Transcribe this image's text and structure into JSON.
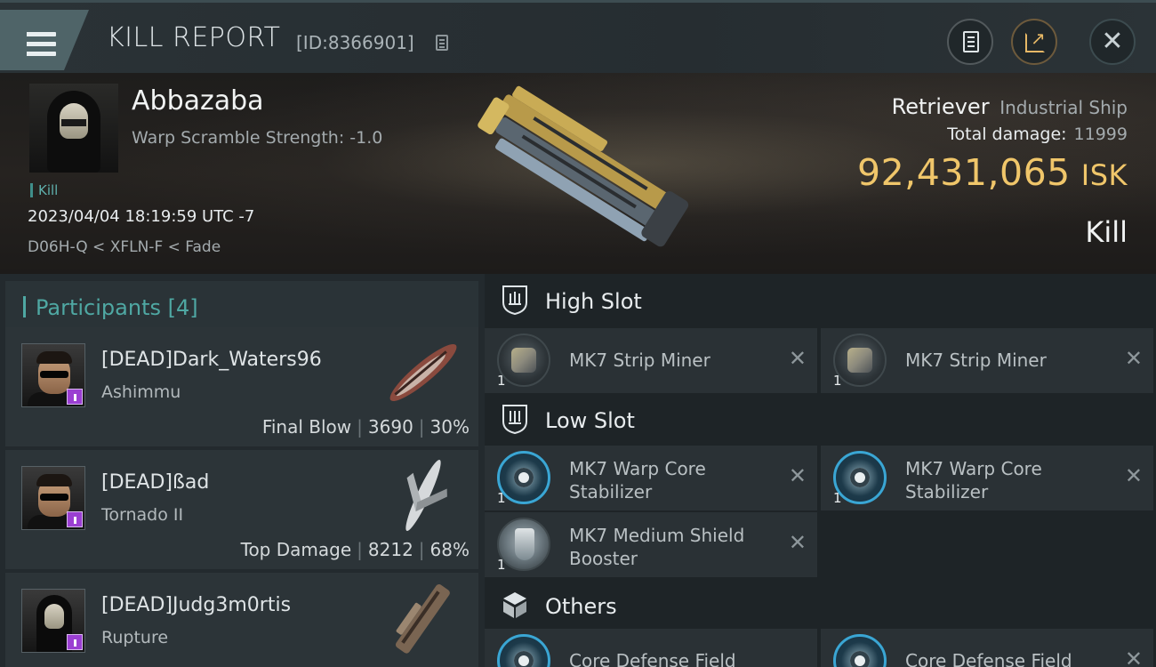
{
  "header": {
    "title": "KILL REPORT",
    "report_id": "[ID:8366901]",
    "buttons": {
      "doc": "document-icon",
      "share": "share-icon",
      "close": "✕"
    }
  },
  "victim": {
    "name": "Abbazaba",
    "warp_scramble": "Warp Scramble Strength: -1.0",
    "tag": "Kill",
    "timestamp": "2023/04/04 18:19:59 UTC -7",
    "location": "D06H-Q < XFLN-F < Fade",
    "ship_name": "Retriever",
    "ship_class": "Industrial Ship",
    "total_damage_label": "Total damage:",
    "total_damage": "11999",
    "isk_value": "92,431,065",
    "isk_unit": "ISK",
    "result": "Kill"
  },
  "participants": {
    "label": "Participants",
    "count": "[4]",
    "rows": [
      {
        "name": "[DEAD]Dark_Waters96",
        "ship": "Ashimmu",
        "role": "Final Blow",
        "damage": "3690",
        "percent": "30%"
      },
      {
        "name": "[DEAD]ßad",
        "ship": "Tornado II",
        "role": "Top Damage",
        "damage": "8212",
        "percent": "68%"
      },
      {
        "name": "[DEAD]Judg3m0rtis",
        "ship": "Rupture",
        "role": "",
        "damage": "",
        "percent": ""
      }
    ]
  },
  "fitting": {
    "high_slot": {
      "label": "High Slot",
      "modules": [
        {
          "name": "MK7 Strip Miner",
          "qty": "1"
        },
        {
          "name": "MK7 Strip Miner",
          "qty": "1"
        }
      ]
    },
    "low_slot": {
      "label": "Low Slot",
      "modules": [
        {
          "name": "MK7 Warp Core Stabilizer",
          "qty": "1"
        },
        {
          "name": "MK7 Warp Core Stabilizer",
          "qty": "1"
        },
        {
          "name": "MK7 Medium Shield Booster",
          "qty": "1"
        }
      ]
    },
    "others": {
      "label": "Others",
      "modules": [
        {
          "name": "Core Defense Field"
        },
        {
          "name": "Core Defense Field"
        }
      ]
    },
    "remove_glyph": "✕"
  },
  "colors": {
    "accent_teal": "#4fa8a3",
    "isk_gold": "#f0c66a",
    "badge_purple": "#9b3fd2"
  }
}
